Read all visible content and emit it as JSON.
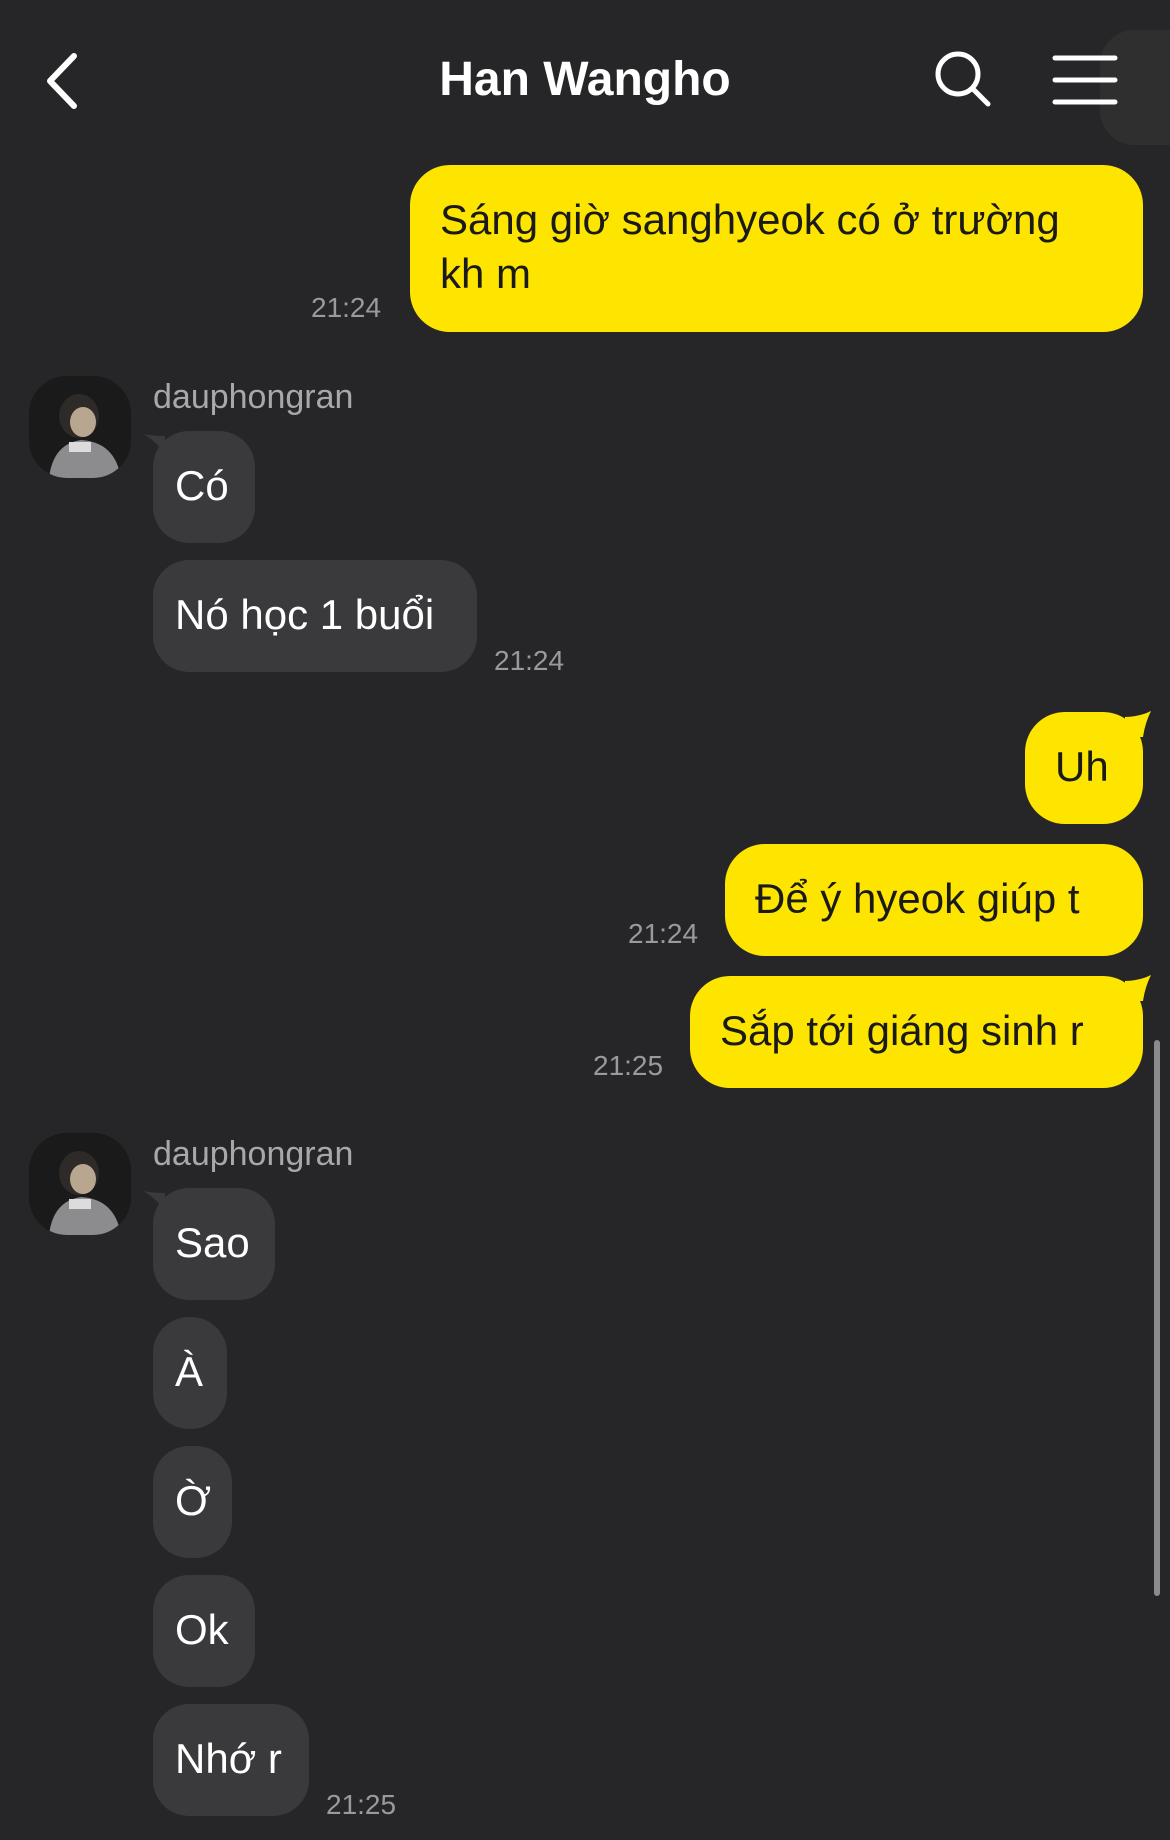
{
  "header": {
    "title": "Han Wangho",
    "back_icon": "chevron-left-icon",
    "search_icon": "search-icon",
    "menu_icon": "hamburger-menu-icon"
  },
  "colors": {
    "background": "#262628",
    "my_bubble": "#fee500",
    "their_bubble": "#3a3a3c",
    "timestamp": "#9a9a9e"
  },
  "messages": {
    "m1": {
      "text": "Sáng giờ sanghyeok có ở trường\nkh m",
      "time": "21:24"
    },
    "group1": {
      "sender": "dauphongran",
      "m1": {
        "text": "Có"
      },
      "m2": {
        "text": "Nó học 1 buổi",
        "time": "21:24"
      }
    },
    "m2": {
      "text": "Uh"
    },
    "m3": {
      "text": "Để ý hyeok giúp t",
      "time": "21:24"
    },
    "m4": {
      "text": "Sắp tới giáng sinh r",
      "time": "21:25"
    },
    "group2": {
      "sender": "dauphongran",
      "m1": {
        "text": "Sao"
      },
      "m2": {
        "text": "À"
      },
      "m3": {
        "text": "Ờ"
      },
      "m4": {
        "text": "Ok"
      },
      "m5": {
        "text": "Nhớ r",
        "time": "21:25"
      }
    }
  }
}
